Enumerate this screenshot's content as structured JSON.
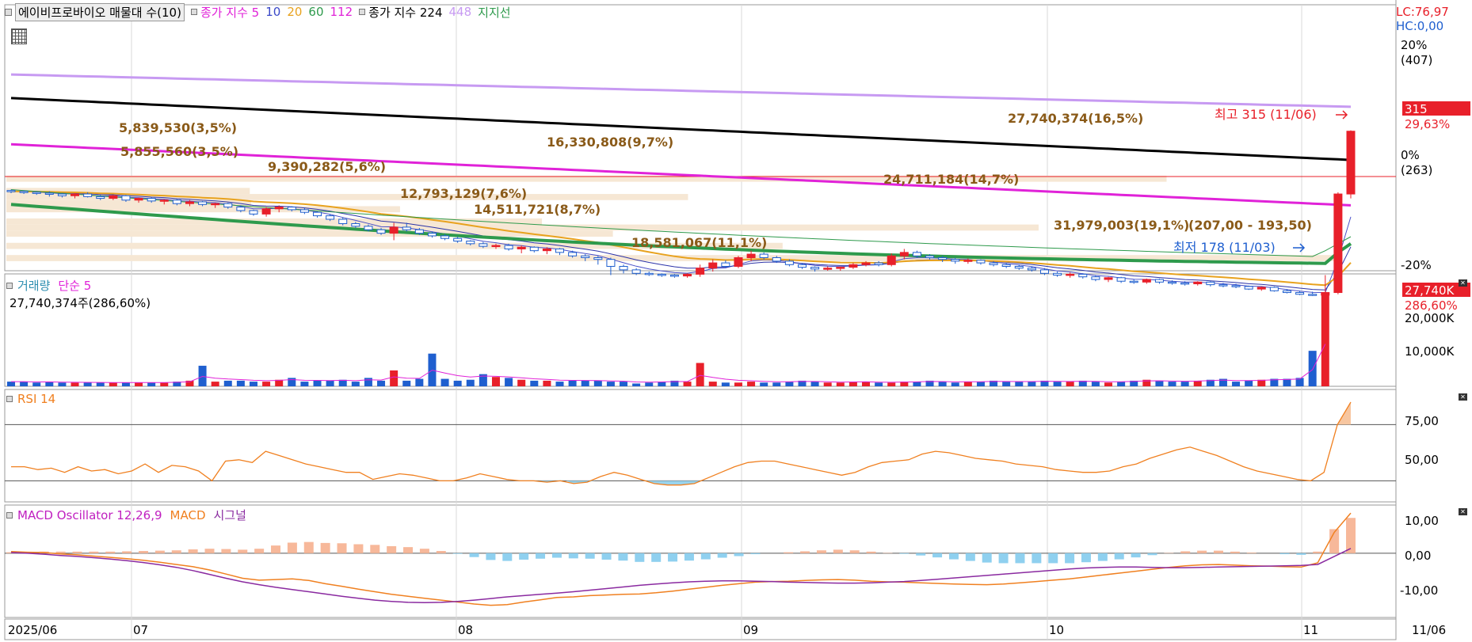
{
  "colors": {
    "up": "#e8202a",
    "down": "#1f5fcf",
    "ma5": "#4a50c8",
    "ma10": "#4a50c8",
    "ma20": "#e8a21e",
    "ma60": "#2e9a4c",
    "ma112": "#e022d8",
    "ma224": "#000000",
    "ma448": "#c79af2",
    "support_fill": "#f6e7d4",
    "support_text": "#8a5a18",
    "rsi": "#f08020",
    "rsi_fill": "#9ad3ec",
    "macd": "#f08020",
    "signal": "#8a2aa0",
    "osc_pos": "#f7b89a",
    "osc_neg": "#8fd0ef",
    "vol_ma": "#e022d8",
    "grid": "#c8c8c8"
  },
  "header": {
    "title": "에이비프로바이오 매물대 수(10)",
    "ma_label": "종가 지수 5",
    "ma_periods": [
      "10",
      "20",
      "60",
      "112"
    ],
    "ma2_label": "종가 지수 224",
    "ma2_period": "448",
    "support_label": "지지선"
  },
  "price_axis": {
    "lc": "LC:76,97",
    "hc": "HC:0,00",
    "ticks": [
      {
        "label": "20%",
        "sub": "(407)"
      },
      {
        "label": "0%",
        "sub": "(263)"
      },
      {
        "label": "-20%",
        "sub": ""
      }
    ],
    "last_price": "315",
    "last_change": "29,63%",
    "high_label": "최고 315 (11/06)",
    "low_label": "최저 178 (11/03)"
  },
  "volume_panel": {
    "title": "거래량",
    "ma_label": "단순 5",
    "summary": "27,740,374주(286,60%)",
    "ticks": [
      "20,000K",
      "10,000K"
    ],
    "last_value": "27,740K",
    "last_change": "286,60%"
  },
  "rsi_panel": {
    "title": "RSI 14",
    "ticks": [
      "75,00",
      "50,00"
    ]
  },
  "macd_panel": {
    "title": "MACD Oscillator 12,26,9",
    "macd_label": "MACD",
    "signal_label": "시그널",
    "ticks": [
      "10,00",
      "0,00",
      "-10,00"
    ]
  },
  "x_axis": {
    "labels": [
      "2025/06",
      "07",
      "08",
      "09",
      "10",
      "11",
      "11/06"
    ]
  },
  "chart_data": {
    "type": "candlestick",
    "price_ymin": 155,
    "price_ymax": 460,
    "candles": [
      [
        247,
        248,
        244,
        246
      ],
      [
        246,
        247,
        243,
        245
      ],
      [
        245,
        246,
        242,
        244
      ],
      [
        244,
        246,
        240,
        243
      ],
      [
        243,
        244,
        239,
        241
      ],
      [
        241,
        244,
        238,
        243
      ],
      [
        243,
        245,
        239,
        240
      ],
      [
        240,
        242,
        236,
        238
      ],
      [
        238,
        242,
        236,
        241
      ],
      [
        241,
        242,
        234,
        236
      ],
      [
        236,
        239,
        233,
        238
      ],
      [
        238,
        239,
        233,
        235
      ],
      [
        235,
        237,
        231,
        236
      ],
      [
        236,
        237,
        230,
        232
      ],
      [
        232,
        236,
        229,
        234
      ],
      [
        234,
        235,
        229,
        231
      ],
      [
        231,
        233,
        227,
        232
      ],
      [
        232,
        233,
        226,
        228
      ],
      [
        228,
        230,
        222,
        224
      ],
      [
        224,
        225,
        218,
        220
      ],
      [
        220,
        228,
        217,
        226
      ],
      [
        226,
        230,
        222,
        228
      ],
      [
        228,
        229,
        223,
        225
      ],
      [
        225,
        227,
        220,
        222
      ],
      [
        222,
        223,
        216,
        218
      ],
      [
        218,
        220,
        212,
        214
      ],
      [
        214,
        216,
        207,
        209
      ],
      [
        209,
        211,
        204,
        206
      ],
      [
        206,
        208,
        200,
        202
      ],
      [
        202,
        204,
        196,
        198
      ],
      [
        198,
        210,
        190,
        205
      ],
      [
        205,
        210,
        200,
        202
      ],
      [
        202,
        204,
        196,
        198
      ],
      [
        198,
        200,
        193,
        195
      ],
      [
        195,
        197,
        190,
        192
      ],
      [
        192,
        194,
        187,
        189
      ],
      [
        189,
        190,
        184,
        186
      ],
      [
        186,
        188,
        181,
        183
      ],
      [
        183,
        186,
        180,
        184
      ],
      [
        184,
        186,
        178,
        180
      ],
      [
        180,
        184,
        175,
        182
      ],
      [
        182,
        183,
        176,
        178
      ],
      [
        178,
        182,
        174,
        180
      ],
      [
        180,
        181,
        173,
        176
      ],
      [
        176,
        178,
        170,
        172
      ],
      [
        172,
        174,
        166,
        170
      ],
      [
        170,
        172,
        162,
        168
      ],
      [
        168,
        170,
        150,
        160
      ],
      [
        160,
        162,
        152,
        156
      ],
      [
        156,
        158,
        150,
        152
      ],
      [
        152,
        154,
        149,
        151
      ],
      [
        151,
        152,
        148,
        150
      ],
      [
        150,
        151,
        147,
        149
      ],
      [
        149,
        152,
        147,
        151
      ],
      [
        151,
        162,
        148,
        158
      ],
      [
        158,
        168,
        154,
        164
      ],
      [
        164,
        167,
        158,
        160
      ],
      [
        160,
        172,
        158,
        170
      ],
      [
        170,
        178,
        166,
        174
      ],
      [
        174,
        176,
        168,
        170
      ],
      [
        170,
        172,
        164,
        166
      ],
      [
        166,
        168,
        160,
        162
      ],
      [
        162,
        164,
        157,
        159
      ],
      [
        159,
        160,
        154,
        157
      ],
      [
        157,
        160,
        155,
        158
      ],
      [
        158,
        160,
        155,
        159
      ],
      [
        159,
        164,
        157,
        162
      ],
      [
        162,
        166,
        160,
        164
      ],
      [
        164,
        166,
        160,
        162
      ],
      [
        162,
        175,
        160,
        172
      ],
      [
        172,
        180,
        168,
        176
      ],
      [
        176,
        178,
        170,
        172
      ],
      [
        172,
        174,
        168,
        170
      ],
      [
        170,
        172,
        165,
        168
      ],
      [
        168,
        170,
        163,
        166
      ],
      [
        166,
        169,
        163,
        167
      ],
      [
        167,
        168,
        162,
        164
      ],
      [
        164,
        166,
        160,
        162
      ],
      [
        162,
        164,
        158,
        160
      ],
      [
        160,
        162,
        156,
        158
      ],
      [
        158,
        160,
        154,
        156
      ],
      [
        156,
        158,
        150,
        152
      ],
      [
        152,
        154,
        148,
        150
      ],
      [
        150,
        153,
        147,
        151
      ],
      [
        151,
        152,
        146,
        148
      ],
      [
        148,
        150,
        143,
        145
      ],
      [
        145,
        148,
        142,
        147
      ],
      [
        147,
        148,
        141,
        143
      ],
      [
        143,
        145,
        140,
        142
      ],
      [
        142,
        146,
        140,
        145
      ],
      [
        145,
        146,
        140,
        142
      ],
      [
        142,
        144,
        139,
        141
      ],
      [
        141,
        143,
        138,
        140
      ],
      [
        140,
        143,
        138,
        142
      ],
      [
        142,
        143,
        137,
        139
      ],
      [
        139,
        141,
        136,
        138
      ],
      [
        138,
        140,
        135,
        137
      ],
      [
        137,
        138,
        133,
        134
      ],
      [
        134,
        137,
        132,
        136
      ],
      [
        136,
        137,
        131,
        132
      ],
      [
        132,
        134,
        129,
        130
      ],
      [
        130,
        132,
        127,
        128
      ],
      [
        128,
        131,
        126,
        127
      ],
      [
        127,
        150,
        126,
        130
      ],
      [
        130,
        245,
        128,
        243
      ]
    ],
    "last_candle": [
      243,
      316,
      238,
      315
    ],
    "volume": [
      5,
      5,
      4,
      5,
      4,
      4,
      4,
      4,
      4,
      4,
      4,
      4,
      4,
      5,
      6,
      22,
      5,
      6,
      6,
      5,
      5,
      7,
      9,
      5,
      6,
      6,
      7,
      5,
      9,
      6,
      17,
      6,
      8,
      35,
      8,
      6,
      7,
      13,
      10,
      9,
      7,
      6,
      6,
      5,
      6,
      6,
      6,
      5,
      5,
      3,
      4,
      5,
      6,
      5,
      25,
      5,
      4,
      4,
      5,
      4,
      4,
      5,
      6,
      5,
      4,
      4,
      5,
      5,
      4,
      4,
      5,
      5,
      6,
      5,
      4,
      5,
      5,
      6,
      5,
      5,
      5,
      6,
      5,
      5,
      6,
      5,
      4,
      5,
      6,
      7,
      6,
      5,
      5,
      6,
      7,
      8,
      5,
      6,
      7,
      8,
      8,
      9,
      38
    ],
    "volume_last": 100,
    "rsi": [
      40,
      40,
      38,
      39,
      36,
      40,
      37,
      38,
      35,
      37,
      42,
      36,
      41,
      40,
      37,
      30,
      44,
      45,
      43,
      51,
      48,
      45,
      42,
      40,
      38,
      36,
      36,
      31,
      33,
      35,
      34,
      32,
      30,
      30,
      32,
      35,
      33,
      31,
      30,
      30,
      29,
      30,
      28,
      29,
      33,
      36,
      34,
      31,
      28,
      27,
      27,
      28,
      32,
      36,
      40,
      43,
      44,
      44,
      42,
      40,
      38,
      36,
      34,
      36,
      40,
      43,
      44,
      45,
      49,
      51,
      50,
      48,
      46,
      45,
      44,
      42,
      41,
      40,
      38,
      37,
      36,
      36,
      37,
      40,
      42,
      46,
      49,
      52,
      54,
      51,
      48,
      44,
      40,
      37,
      35,
      33,
      31,
      30,
      36,
      70,
      86
    ],
    "macd": [
      0.5,
      0.3,
      0.2,
      -0.2,
      -0.5,
      -0.9,
      -1.3,
      -1.7,
      -2.2,
      -2.8,
      -3.5,
      -4.2,
      -5.2,
      -6.5,
      -7.8,
      -8.4,
      -8.2,
      -8.0,
      -8.5,
      -9.5,
      -10.3,
      -11.2,
      -12.0,
      -12.8,
      -13.4,
      -14.0,
      -14.6,
      -15.2,
      -15.8,
      -16.2,
      -16.0,
      -15.2,
      -14.5,
      -13.8,
      -13.6,
      -13.2,
      -13.0,
      -12.8,
      -12.7,
      -12.3,
      -11.8,
      -11.2,
      -10.6,
      -10.0,
      -9.5,
      -9.0,
      -8.8,
      -8.7,
      -8.5,
      -8.3,
      -8.2,
      -8.4,
      -8.7,
      -8.9,
      -9.0,
      -9.2,
      -9.4,
      -9.6,
      -9.7,
      -9.8,
      -9.6,
      -9.2,
      -8.8,
      -8.4,
      -8.0,
      -7.4,
      -6.8,
      -6.2,
      -5.6,
      -5.0,
      -4.4,
      -3.9,
      -3.6,
      -3.5,
      -3.7,
      -3.9,
      -4.0,
      -4.2,
      -4.3,
      -3.0,
      6.5,
      12.5
    ],
    "signal": [
      0.2,
      0.0,
      -0.3,
      -0.7,
      -1.0,
      -1.4,
      -1.8,
      -2.3,
      -2.9,
      -3.6,
      -4.4,
      -5.4,
      -6.6,
      -7.8,
      -8.9,
      -9.8,
      -10.6,
      -11.3,
      -12.0,
      -12.7,
      -13.4,
      -14.0,
      -14.6,
      -15.0,
      -15.3,
      -15.4,
      -15.3,
      -15.0,
      -14.6,
      -14.1,
      -13.6,
      -13.2,
      -12.8,
      -12.4,
      -12.0,
      -11.5,
      -11.0,
      -10.5,
      -10.0,
      -9.6,
      -9.2,
      -8.9,
      -8.7,
      -8.6,
      -8.6,
      -8.7,
      -8.8,
      -9.0,
      -9.1,
      -9.2,
      -9.3,
      -9.3,
      -9.2,
      -9.0,
      -8.8,
      -8.5,
      -8.1,
      -7.7,
      -7.3,
      -6.9,
      -6.5,
      -6.1,
      -5.7,
      -5.3,
      -4.9,
      -4.6,
      -4.4,
      -4.3,
      -4.3,
      -4.4,
      -4.5,
      -4.5,
      -4.4,
      -4.3,
      -4.2,
      -4.1,
      -4.0,
      -3.9,
      -3.8,
      -3.5,
      -1.0,
      1.5
    ],
    "support_bands": [
      {
        "label": "5,839,530(3,5%)",
        "lo": 243,
        "hi": 250,
        "w": 0.175
      },
      {
        "label": "5,855,560(3,5%)",
        "lo": 229,
        "hi": 236,
        "w": 0.176
      },
      {
        "label": "9,390,282(5,6%)",
        "lo": 222,
        "hi": 229,
        "w": 0.283
      },
      {
        "label": "12,793,129(7,6%)",
        "lo": 208,
        "hi": 215,
        "w": 0.385
      },
      {
        "label": "14,511,721(8,7%)",
        "lo": 194,
        "hi": 201,
        "w": 0.436
      },
      {
        "label": "18,581,067(11,1%)",
        "lo": 180,
        "hi": 187,
        "w": 0.558
      },
      {
        "label": "16,330,808(9,7%)",
        "lo": 236,
        "hi": 243,
        "w": 0.49
      },
      {
        "label": "24,711,184(14,7%)",
        "lo": 201,
        "hi": 208,
        "w": 0.742
      },
      {
        "label": "31,979,003(19,1%)",
        "lo": 166,
        "hi": 173,
        "w": 0.96
      },
      {
        "label": "27,740,374(16,5%)",
        "lo": 257,
        "hi": 264,
        "w": 0.834
      }
    ],
    "extra_label": "(207,00 - 193,50)"
  }
}
